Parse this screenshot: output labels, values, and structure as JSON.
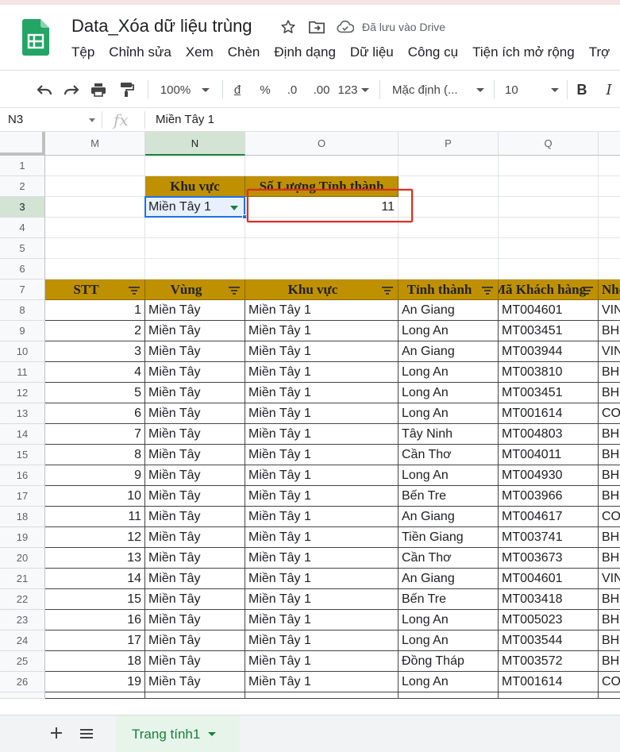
{
  "app": {
    "doc_title": "Data_Xóa dữ liệu trùng",
    "saved_status": "Đã lưu vào Drive",
    "menu": [
      "Tệp",
      "Chỉnh sửa",
      "Xem",
      "Chèn",
      "Định dạng",
      "Dữ liệu",
      "Công cụ",
      "Tiện ích mở rộng",
      "Trợ"
    ]
  },
  "toolbar": {
    "zoom": "100%",
    "currency": "đ",
    "percent": "%",
    "decrease_decimal": ".0",
    "increase_decimal": ".00",
    "more_formats": "123",
    "font": "Mặc định (...",
    "font_size": "10",
    "bold": "B",
    "italic": "I"
  },
  "formula_bar": {
    "name_box": "N3",
    "fx": "fx",
    "value": "Miền Tây 1"
  },
  "grid": {
    "columns": [
      "M",
      "N",
      "O",
      "P",
      "Q"
    ],
    "rows": [
      "1",
      "2",
      "3",
      "4",
      "5",
      "6",
      "7",
      "8",
      "9",
      "10",
      "11",
      "12",
      "13",
      "14",
      "15",
      "16",
      "17",
      "18",
      "19",
      "20",
      "21",
      "22",
      "23",
      "24",
      "25",
      "26"
    ],
    "summary": {
      "header_region": "Khu vực",
      "header_count": "Số Lượng Tỉnh thành",
      "region_value": "Miền Tây 1",
      "count_value": "11"
    },
    "table_headers": [
      "STT",
      "Vùng",
      "Khu vực",
      "Tỉnh thành",
      "Mã Khách hàng",
      "Nhóm"
    ],
    "table_rows": [
      [
        "1",
        "Miền Tây",
        "Miền Tây 1",
        "An Giang",
        "MT004601",
        "VIN"
      ],
      [
        "2",
        "Miền Tây",
        "Miền Tây 1",
        "Long An",
        "MT003451",
        "BH"
      ],
      [
        "3",
        "Miền Tây",
        "Miền Tây 1",
        "An Giang",
        "MT003944",
        "VIN"
      ],
      [
        "4",
        "Miền Tây",
        "Miền Tây 1",
        "Long An",
        "MT003810",
        "BH"
      ],
      [
        "5",
        "Miền Tây",
        "Miền Tây 1",
        "Long An",
        "MT003451",
        "BH"
      ],
      [
        "6",
        "Miền Tây",
        "Miền Tây 1",
        "Long An",
        "MT001614",
        "CO"
      ],
      [
        "7",
        "Miền Tây",
        "Miền Tây 1",
        "Tây Ninh",
        "MT004803",
        "BH"
      ],
      [
        "8",
        "Miền Tây",
        "Miền Tây 1",
        "Cần Thơ",
        "MT004011",
        "BH"
      ],
      [
        "9",
        "Miền Tây",
        "Miền Tây 1",
        "Long An",
        "MT004930",
        "BH"
      ],
      [
        "10",
        "Miền Tây",
        "Miền Tây 1",
        "Bến Tre",
        "MT003966",
        "BH"
      ],
      [
        "11",
        "Miền Tây",
        "Miền Tây 1",
        "An Giang",
        "MT004617",
        "CO"
      ],
      [
        "12",
        "Miền Tây",
        "Miền Tây 1",
        "Tiền Giang",
        "MT003741",
        "BH"
      ],
      [
        "13",
        "Miền Tây",
        "Miền Tây 1",
        "Cần Thơ",
        "MT003673",
        "BH"
      ],
      [
        "14",
        "Miền Tây",
        "Miền Tây 1",
        "An Giang",
        "MT004601",
        "VIN"
      ],
      [
        "15",
        "Miền Tây",
        "Miền Tây 1",
        "Bến Tre",
        "MT003418",
        "BH"
      ],
      [
        "16",
        "Miền Tây",
        "Miền Tây 1",
        "Long An",
        "MT005023",
        "BH"
      ],
      [
        "17",
        "Miền Tây",
        "Miền Tây 1",
        "Long An",
        "MT003544",
        "BH"
      ],
      [
        "18",
        "Miền Tây",
        "Miền Tây 1",
        "Đồng Tháp",
        "MT003572",
        "BH"
      ],
      [
        "19",
        "Miền Tây",
        "Miền Tây 1",
        "Long An",
        "MT001614",
        "CO"
      ]
    ]
  },
  "sheets": {
    "active_tab": "Trang tính1"
  },
  "colors": {
    "header_gold": "#bf9000",
    "selection_blue": "#1a73e8",
    "highlight_red": "#d93025",
    "sheets_green": "#188038"
  }
}
